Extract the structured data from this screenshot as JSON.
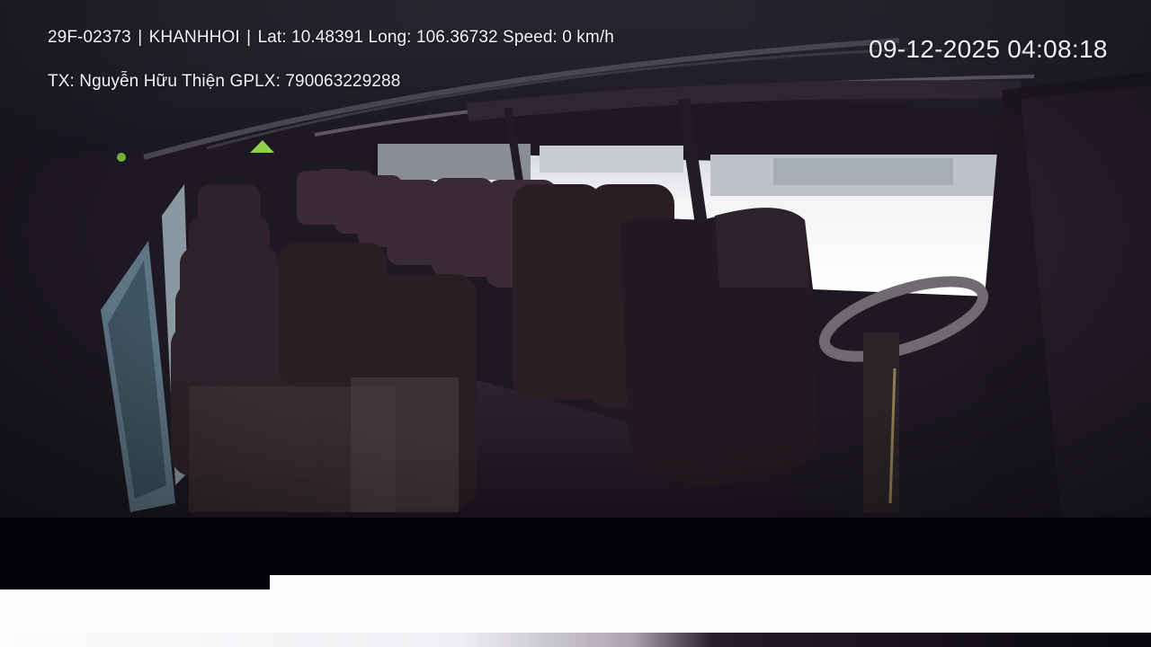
{
  "overlay": {
    "plate": "29F-02373",
    "company": "KHANHHOI",
    "lat_label": "Lat:",
    "lat": "10.48391",
    "long_label": "Long:",
    "long": "106.36732",
    "speed_label": "Speed:",
    "speed": "0 km/h",
    "separator": "|",
    "driver_label": "TX:",
    "driver_name": "Nguyễn Hữu Thiện",
    "license_label": "GPLX:",
    "license_number": "790063229288",
    "timestamp": "09-12-2025 04:08:18"
  },
  "colors": {
    "interior_dark": "#1c161f",
    "seat": "#2e1f27",
    "window_light": "#eef0f3",
    "bottom_band": "#05020a",
    "page_bg": "#fcfbfd"
  }
}
